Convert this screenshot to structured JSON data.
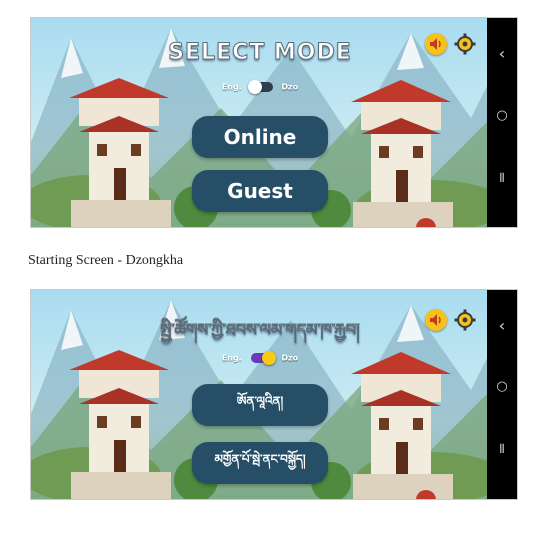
{
  "caption": "Starting Screen - Dzongkha",
  "english_screen": {
    "title": "SELECT MODE",
    "toggle_left": "Eng.",
    "toggle_right": "Dzo",
    "button_online": "Online",
    "button_guest": "Guest"
  },
  "dzongkha_screen": {
    "title": "སྤྱི་ཚོགས་ཀྱི་ཐབས་ལམ་གདམ་ཁ་རྐྱབ།",
    "toggle_left": "Eng.",
    "toggle_right": "Dzo",
    "button_online": "ཨོན་ལཱའིན།",
    "button_guest": "མགྱོན་པོ་སྦེ་ནང་བསྐྱོད།"
  },
  "nav": {
    "chevron_up": "˄",
    "back": "‹",
    "home": "○",
    "recents": "⦀"
  },
  "icons": {
    "sound": "speaker-icon",
    "settings": "gear-icon"
  },
  "colors": {
    "button_bg": "#264e66",
    "toggle_on": "#6a3bb8",
    "knob_on": "#f7cb14",
    "speaker": "#f5c21b"
  }
}
